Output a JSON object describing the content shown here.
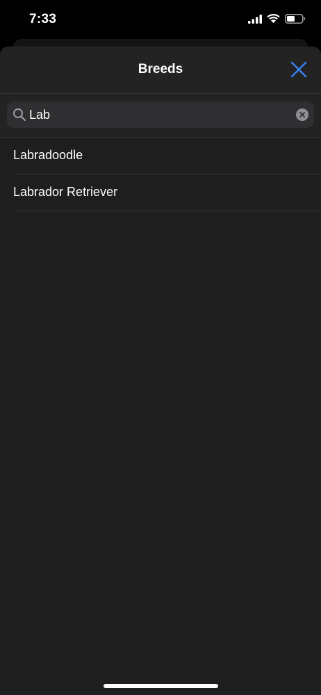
{
  "status_bar": {
    "time": "7:33",
    "icons": [
      "cellular-signal-icon",
      "wifi-icon",
      "battery-icon"
    ]
  },
  "sheet": {
    "title": "Breeds",
    "close_icon": "close-icon",
    "search": {
      "value": "Lab",
      "placeholder": "Search",
      "icon": "search-icon",
      "clear_icon": "clear-icon"
    },
    "results": [
      {
        "label": "Labradoodle"
      },
      {
        "label": "Labrador Retriever"
      }
    ]
  },
  "colors": {
    "accent": "#3a82f7",
    "background": "#1e1e1e",
    "separator": "#333335"
  }
}
